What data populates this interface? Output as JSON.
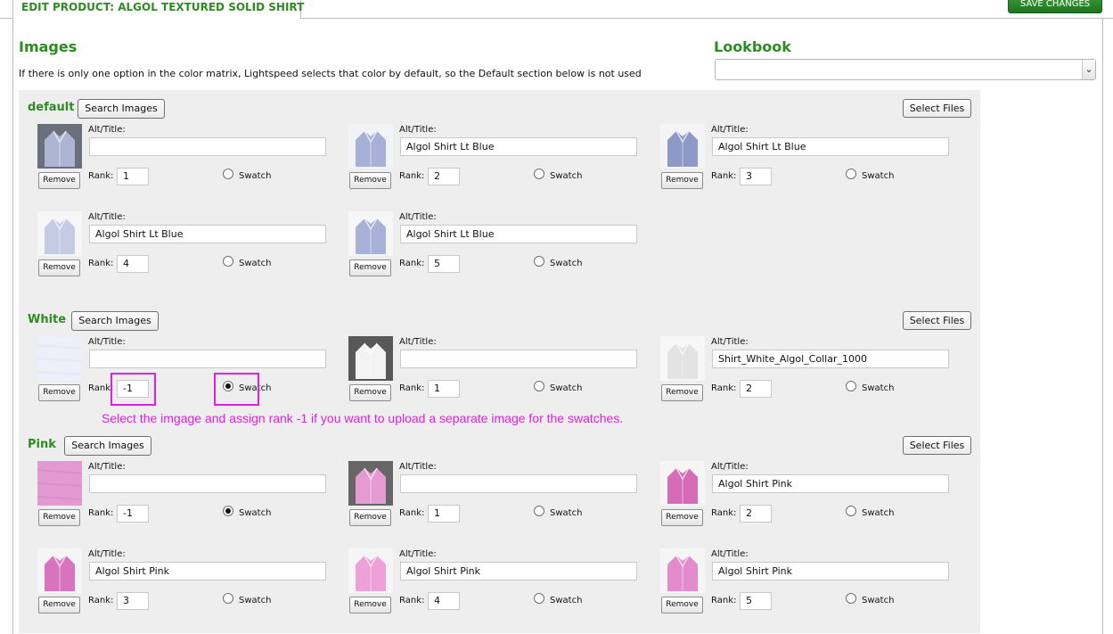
{
  "header": {
    "tab_title": "EDIT PRODUCT: ALGOL TEXTURED SOLID SHIRT",
    "save_label": "SAVE CHANGES"
  },
  "images_heading": "Images",
  "lookbook_heading": "Lookbook",
  "note": "If there is only one option in the color matrix, Lightspeed selects that color by default, so the Default section below is not used",
  "lookbook_select": "",
  "labels": {
    "alt": "Alt/Title:",
    "rank": "Rank:",
    "swatch": "Swatch",
    "remove": "Remove",
    "search_images": "Search Images",
    "select_files": "Select Files"
  },
  "sections": [
    {
      "name": "default",
      "items": [
        {
          "alt": "",
          "rank": "1",
          "swatch": false,
          "thumb": "shirt-lt-blue-folded"
        },
        {
          "alt": "Algol Shirt Lt Blue",
          "rank": "2",
          "swatch": false,
          "thumb": "shirt-lt-blue-front"
        },
        {
          "alt": "Algol Shirt Lt Blue",
          "rank": "3",
          "swatch": false,
          "thumb": "shirt-lt-blue-collar"
        },
        {
          "alt": "Algol Shirt Lt Blue",
          "rank": "4",
          "swatch": false,
          "thumb": "shirt-lt-blue-cuff"
        },
        {
          "alt": "Algol Shirt Lt Blue",
          "rank": "5",
          "swatch": false,
          "thumb": "shirt-lt-blue-sleeve"
        }
      ]
    },
    {
      "name": "White",
      "items": [
        {
          "alt": "",
          "rank": "-1",
          "swatch": true,
          "thumb": "white-fabric-swatch"
        },
        {
          "alt": "",
          "rank": "1",
          "swatch": false,
          "thumb": "shirt-white-folded"
        },
        {
          "alt": "Shirt_White_Algol_Collar_1000",
          "rank": "2",
          "swatch": false,
          "thumb": "shirt-white-collar"
        }
      ]
    },
    {
      "name": "Pink",
      "items": [
        {
          "alt": "",
          "rank": "-1",
          "swatch": true,
          "thumb": "pink-fabric-swatch"
        },
        {
          "alt": "",
          "rank": "1",
          "swatch": false,
          "thumb": "shirt-pink-folded"
        },
        {
          "alt": "Algol Shirt Pink",
          "rank": "2",
          "swatch": false,
          "thumb": "shirt-pink-front"
        },
        {
          "alt": "Algol Shirt Pink",
          "rank": "3",
          "swatch": false,
          "thumb": "shirt-pink-collar"
        },
        {
          "alt": "Algol Shirt Pink",
          "rank": "4",
          "swatch": false,
          "thumb": "shirt-pink-cuff"
        },
        {
          "alt": "Algol Shirt Pink",
          "rank": "5",
          "swatch": false,
          "thumb": "shirt-pink-sleeve"
        }
      ]
    }
  ],
  "annotation": "Select the imgage and assign rank -1 if you want to upload a separate image for the swatches.",
  "colors": {
    "brand_green": "#2e8b22",
    "highlight": "#e020e0",
    "section_bg": "#eeeeee"
  }
}
